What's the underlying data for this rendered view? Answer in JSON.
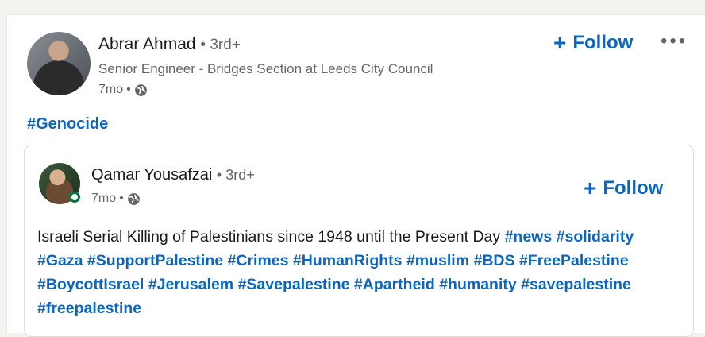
{
  "post": {
    "author_name": "Abrar Ahmad",
    "author_degree": "3rd+",
    "author_headline": "Senior Engineer - Bridges Section at Leeds City Council",
    "time": "7mo",
    "follow_label": "Follow",
    "more_label": "•••",
    "hashtag": "#Genocide"
  },
  "shared": {
    "author_name": "Qamar Yousafzai",
    "author_degree": "3rd+",
    "time": "7mo",
    "follow_label": "Follow",
    "text": "Israeli Serial Killing of Palestinians since 1948 until the Present Day",
    "hashtags": [
      "#news",
      "#solidarity",
      "#Gaza",
      "#SupportPalestine",
      "#Crimes",
      "#HumanRights",
      "#muslim",
      "#BDS",
      "#FreePalestine",
      "#BoycottIsrael",
      "#Jerusalem",
      "#Savepalestine",
      "#Apartheid",
      "#humanity",
      "#savepalestine",
      "#freepalestine"
    ]
  },
  "colors": {
    "link": "#0a66c2",
    "online": "#057642"
  },
  "icons": {
    "visibility": "globe-icon",
    "more": "more-horizontal-icon",
    "follow": "plus-icon"
  }
}
